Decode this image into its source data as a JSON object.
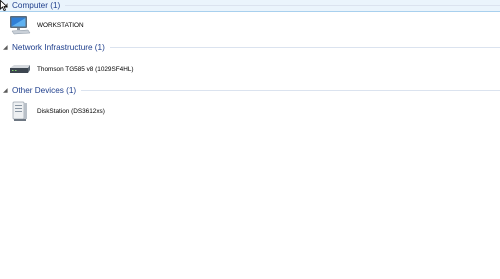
{
  "groups": [
    {
      "title": "Computer (1)",
      "items": [
        {
          "label": "WORKSTATION",
          "icon": "computer-icon"
        }
      ]
    },
    {
      "title": "Network Infrastructure (1)",
      "items": [
        {
          "label": "Thomson TG585 v8 (1029SF4HL)",
          "icon": "router-icon"
        }
      ]
    },
    {
      "title": "Other Devices (1)",
      "items": [
        {
          "label": "DiskStation (DS3612xs)",
          "icon": "nas-icon"
        }
      ]
    }
  ],
  "colors": {
    "header_text": "#1e3e8c",
    "selected_bg": "#eaf4fc",
    "divider": "#dbe3ef"
  }
}
